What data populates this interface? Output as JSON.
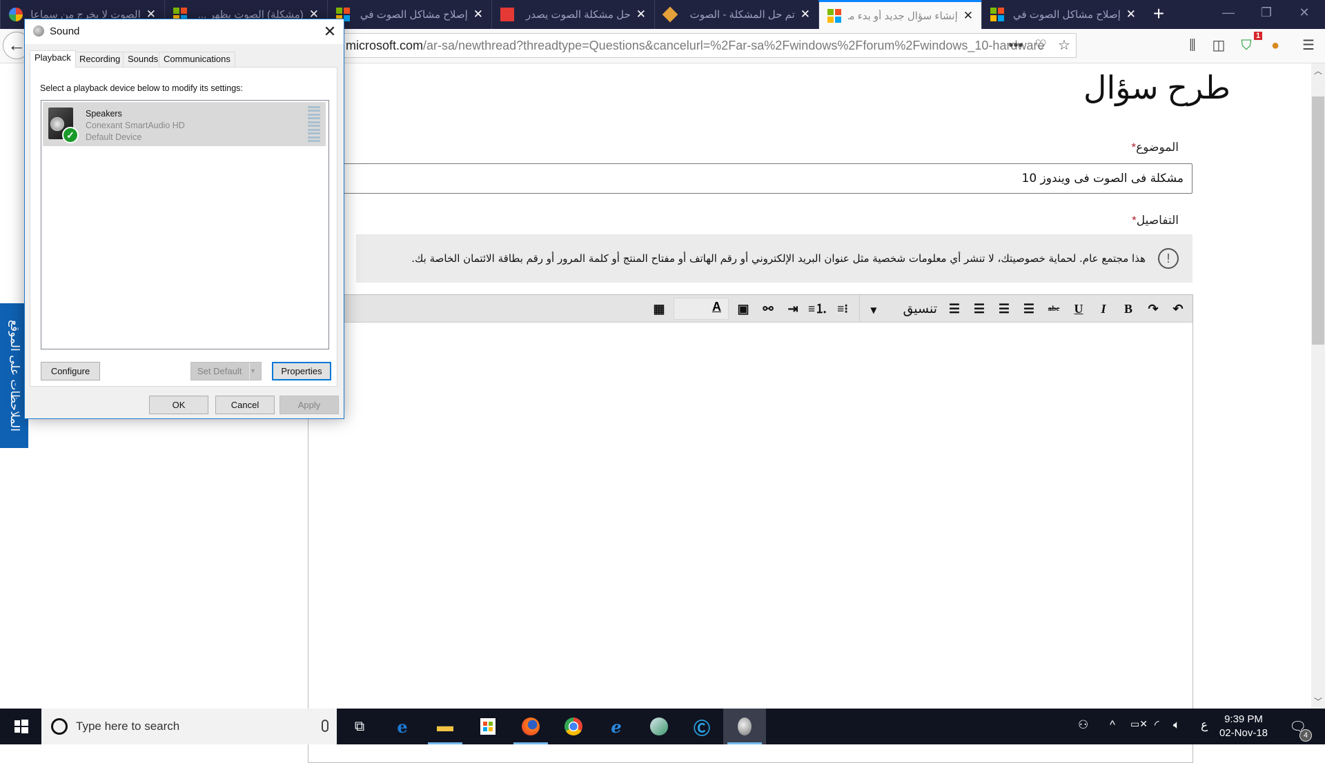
{
  "browser": {
    "tabs": [
      {
        "title": "الصوت لا يخرج من سماعات",
        "favicon": "google-icon",
        "active": false
      },
      {
        "title": "(مشكلة) الصوت يظهر ...",
        "favicon": "microsoft-icon",
        "active": false
      },
      {
        "title": "إصلاح مشاكل الصوت في",
        "favicon": "microsoft-icon",
        "active": false
      },
      {
        "title": "حل مشكلة الصوت يصدر",
        "favicon": "red-site-icon",
        "active": false
      },
      {
        "title": "تم حل المشكلة - الصوت",
        "favicon": "shield-site-icon",
        "active": false
      },
      {
        "title": "إنشاء سؤال جديد أو بدء مناقشة",
        "favicon": "microsoft-icon",
        "active": true
      },
      {
        "title": "إصلاح مشاكل الصوت في",
        "favicon": "microsoft-icon",
        "active": false
      }
    ],
    "new_tab_label": "+",
    "url_domain": "microsoft.com",
    "url_path": "/ar-sa/newthread?threadtype=Questions&cancelurl=%2Far-sa%2Fwindows%2Fforum%2Fwindows_10-hardware",
    "toolbar_icons": [
      "page-actions-icon",
      "pocket-icon",
      "bookmark-star-icon",
      "library-icon",
      "sidebar-icon",
      "extension-shield-icon",
      "extension-ant-icon",
      "menu-icon"
    ],
    "extension_badge": "1",
    "window_controls": {
      "minimize": "—",
      "restore": "❐",
      "close": "✕"
    }
  },
  "page": {
    "title": "طرح سؤال",
    "subject_label": "الموضوع",
    "required_mark": "*",
    "subject_value": "مشكلة فى الصوت فى ويندوز 10",
    "details_label": "التفاصيل",
    "privacy_notice": "هذا مجتمع عام. لحماية خصوصيتك، لا تنشر أي معلومات شخصية مثل عنوان البريد الإلكتروني أو رقم الهاتف أو مفتاح المنتج أو كلمة المرور أو رقم بطاقة الائتمان الخاصة بك.",
    "editor_toolbar": {
      "undo": "↶",
      "redo": "↷",
      "bold": "B",
      "italic": "I",
      "underline": "U",
      "strikethrough": "abc",
      "format_label": "تنسيق",
      "format_arrow": "▼"
    },
    "feedback_tab": "الملاحظات على الموقع"
  },
  "sound_dialog": {
    "title": "Sound",
    "close": "✕",
    "tabs": [
      "Playback",
      "Recording",
      "Sounds",
      "Communications"
    ],
    "active_tab": "Playback",
    "instruction": "Select a playback device below to modify its settings:",
    "devices": [
      {
        "name": "Speakers",
        "driver": "Conexant SmartAudio HD",
        "status": "Default Device",
        "default": true,
        "level_percent": 0
      }
    ],
    "buttons": {
      "configure": "Configure",
      "set_default": "Set Default",
      "properties": "Properties",
      "ok": "OK",
      "cancel": "Cancel",
      "apply": "Apply"
    }
  },
  "taskbar": {
    "search_placeholder": "Type here to search",
    "apps": [
      "task-view-icon",
      "edge-icon",
      "file-explorer-icon",
      "store-icon",
      "firefox-icon",
      "chrome-icon",
      "internet-explorer-icon",
      "app-globe-icon",
      "app-c-icon",
      "sound-app-icon"
    ],
    "tray": {
      "people": "people-icon",
      "chevron": "^",
      "battery": "battery-icon",
      "wifi": "wifi-icon",
      "volume": "volume-icon",
      "input_language": "ع"
    },
    "time": "9:39 PM",
    "date": "02-Nov-18",
    "notification_count": "4"
  }
}
